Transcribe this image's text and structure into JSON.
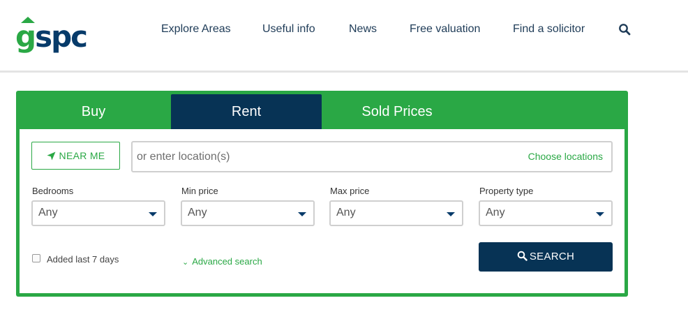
{
  "logo": {
    "letter_g": "g",
    "letters_rest": "spc"
  },
  "nav": {
    "items": [
      {
        "label": "Explore Areas"
      },
      {
        "label": "Useful info"
      },
      {
        "label": "News"
      },
      {
        "label": "Free valuation"
      },
      {
        "label": "Find a solicitor"
      }
    ],
    "search_icon": "search-icon"
  },
  "tabs": [
    {
      "label": "Buy",
      "active": false
    },
    {
      "label": "Rent",
      "active": true
    },
    {
      "label": "Sold Prices",
      "active": false
    }
  ],
  "search": {
    "near_me_label": "NEAR ME",
    "near_me_icon": "location-arrow-icon",
    "location_placeholder": "or enter location(s)",
    "location_value": "",
    "choose_locations_label": "Choose locations",
    "filters": [
      {
        "label": "Bedrooms",
        "value": "Any"
      },
      {
        "label": "Min price",
        "value": "Any"
      },
      {
        "label": "Max price",
        "value": "Any"
      },
      {
        "label": "Property type",
        "value": "Any"
      }
    ],
    "added_last_label": "Added last 7 days",
    "added_last_checked": false,
    "advanced_label": "Advanced search",
    "search_button_label": "SEARCH"
  },
  "colors": {
    "brand_green": "#2aa845",
    "brand_navy": "#073355",
    "nav_text": "#1e3b57"
  }
}
